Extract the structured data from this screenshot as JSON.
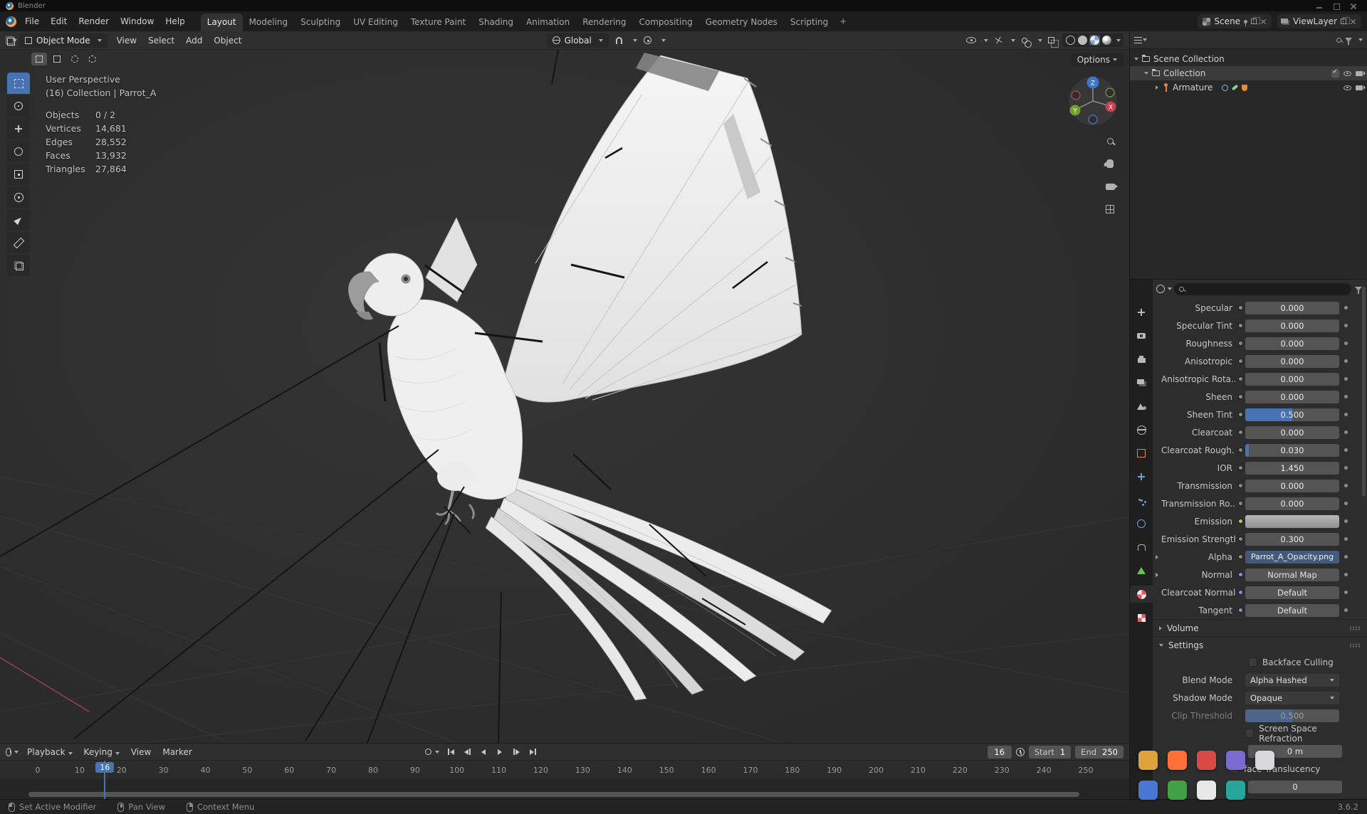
{
  "accent": "#4772b3",
  "titlebar": {
    "title": "Blender"
  },
  "topbar": {
    "menus": [
      "File",
      "Edit",
      "Render",
      "Window",
      "Help"
    ],
    "workspaces": [
      "Layout",
      "Modeling",
      "Sculpting",
      "UV Editing",
      "Texture Paint",
      "Shading",
      "Animation",
      "Rendering",
      "Compositing",
      "Geometry Nodes",
      "Scripting"
    ],
    "active_workspace": "Layout",
    "add_tab": "+",
    "scene_name": "Scene",
    "view_layer_name": "ViewLayer"
  },
  "viewport_header": {
    "mode": "Object Mode",
    "menus": [
      "View",
      "Select",
      "Add",
      "Object"
    ],
    "orientation": "Global",
    "options": "Options"
  },
  "viewport": {
    "overlay": {
      "line1": "User Perspective",
      "line2": "(16) Collection | Parrot_A",
      "stats": [
        {
          "label": "Objects",
          "value": "0 / 2"
        },
        {
          "label": "Vertices",
          "value": "14,681"
        },
        {
          "label": "Edges",
          "value": "28,552"
        },
        {
          "label": "Faces",
          "value": "13,932"
        },
        {
          "label": "Triangles",
          "value": "27,864"
        }
      ]
    },
    "axis": {
      "x": "X",
      "y": "Y",
      "z": "Z"
    },
    "tools": [
      {
        "name": "select-box-tool",
        "kind": "dashed-square",
        "active": true
      },
      {
        "name": "cursor-tool",
        "kind": "circle-cross",
        "active": false
      },
      {
        "name": "move-tool",
        "kind": "cross",
        "active": false
      },
      {
        "name": "rotate-tool",
        "kind": "ring",
        "active": false
      },
      {
        "name": "scale-tool",
        "kind": "square-dot",
        "active": false
      },
      {
        "name": "transform-tool",
        "kind": "ring-dot",
        "active": false
      },
      {
        "name": "annotate-tool",
        "kind": "pen",
        "active": false
      },
      {
        "name": "measure-tool",
        "kind": "ruler",
        "active": false
      },
      {
        "name": "add-cube-tool",
        "kind": "cube",
        "active": false
      }
    ]
  },
  "outliner": {
    "scene_collection": "Scene Collection",
    "collection": "Collection",
    "armature": "Armature"
  },
  "properties": {
    "tabs": [
      {
        "name": "tool-icon",
        "kind": "cross",
        "color": "#b8b8b8",
        "active": false
      },
      {
        "name": "render-icon",
        "kind": "camera",
        "color": "#b8b8b8",
        "active": false
      },
      {
        "name": "output-icon",
        "kind": "printer",
        "color": "#b8b8b8",
        "active": false
      },
      {
        "name": "view-layer-icon",
        "kind": "layers",
        "color": "#b8b8b8",
        "active": false
      },
      {
        "name": "scene-icon",
        "kind": "scene",
        "color": "#b8b8b8",
        "active": false
      },
      {
        "name": "world-icon",
        "kind": "globe",
        "color": "#b8b8b8",
        "active": false
      },
      {
        "name": "object-icon",
        "kind": "square-outline",
        "color": "#e8883a",
        "active": false
      },
      {
        "name": "modifiers-icon",
        "kind": "cross",
        "color": "#6f9fd8",
        "active": false
      },
      {
        "name": "particles-icon",
        "kind": "dots",
        "color": "#6f9fd8",
        "active": false
      },
      {
        "name": "physics-icon",
        "kind": "ring",
        "color": "#6f9fd8",
        "active": false
      },
      {
        "name": "constraints-icon",
        "kind": "clamp",
        "color": "#b8b8b8",
        "active": false
      },
      {
        "name": "object-data-icon",
        "kind": "triangle",
        "color": "#6cc24a",
        "active": false
      },
      {
        "name": "material-icon",
        "kind": "sphere-checker",
        "color": "#e05a5a",
        "active": true
      },
      {
        "name": "texture-icon",
        "kind": "checker",
        "color": "#e05a5a",
        "active": false
      }
    ],
    "rows": [
      {
        "type": "slider",
        "label": "Specular",
        "value": "0.000",
        "fill": 0,
        "socket": "#8c8c8c"
      },
      {
        "type": "slider",
        "label": "Specular Tint",
        "value": "0.000",
        "fill": 0,
        "socket": "#8c8c8c"
      },
      {
        "type": "slider",
        "label": "Roughness",
        "value": "0.000",
        "fill": 0,
        "socket": "#8c8c8c"
      },
      {
        "type": "slider",
        "label": "Anisotropic",
        "value": "0.000",
        "fill": 0,
        "socket": "#8c8c8c"
      },
      {
        "type": "slider",
        "label": "Anisotropic Rota...",
        "value": "0.000",
        "fill": 0,
        "socket": "#8c8c8c"
      },
      {
        "type": "slider",
        "label": "Sheen",
        "value": "0.000",
        "fill": 0,
        "socket": "#8c8c8c"
      },
      {
        "type": "slider",
        "label": "Sheen Tint",
        "value": "0.500",
        "fill": 50,
        "socket": "#8c8c8c"
      },
      {
        "type": "slider",
        "label": "Clearcoat",
        "value": "0.000",
        "fill": 0,
        "socket": "#8c8c8c"
      },
      {
        "type": "slider",
        "label": "Clearcoat Rough...",
        "value": "0.030",
        "fill": 4,
        "socket": "#8c8c8c"
      },
      {
        "type": "slider",
        "label": "IOR",
        "value": "1.450",
        "fill": 0,
        "socket": "#8c8c8c"
      },
      {
        "type": "slider",
        "label": "Transmission",
        "value": "0.000",
        "fill": 0,
        "socket": "#8c8c8c"
      },
      {
        "type": "slider",
        "label": "Transmission Ro...",
        "value": "0.000",
        "fill": 0,
        "socket": "#8c8c8c"
      },
      {
        "type": "color",
        "label": "Emission",
        "socket": "#c9c94a"
      },
      {
        "type": "slider",
        "label": "Emission Strength",
        "value": "0.300",
        "fill": 0,
        "socket": "#8c8c8c"
      },
      {
        "type": "map",
        "label": "Alpha",
        "value": "Parrot_A_Opacity.png",
        "field": "image",
        "socket": "#8c8c8c",
        "expand": true
      },
      {
        "type": "map",
        "label": "Normal",
        "value": "Normal Map",
        "field": "plain",
        "socket": "#8f8fd4",
        "expand": true
      },
      {
        "type": "map",
        "label": "Clearcoat Normal",
        "value": "Default",
        "field": "plain",
        "socket": "#8f8fd4",
        "expand": false
      },
      {
        "type": "map",
        "label": "Tangent",
        "value": "Default",
        "field": "plain",
        "socket": "#8f8fd4",
        "expand": false
      }
    ],
    "volume_section": "Volume",
    "settings_section": "Settings",
    "settings": {
      "backface": "Backface Culling",
      "blend_mode_label": "Blend Mode",
      "blend_mode_value": "Alpha Hashed",
      "shadow_mode_label": "Shadow Mode",
      "shadow_mode_value": "Opaque",
      "clip_label": "Clip Threshold",
      "clip_value": "0.500",
      "ssr_label": "Screen Space Refraction",
      "depth_value": "0 m",
      "translucency_label": "face Translucency",
      "pass_value": "0"
    }
  },
  "overlay_icons": {
    "row1": [
      {
        "name": "app-icon-yellow",
        "color": "#e0a33b"
      },
      {
        "name": "app-icon-firefox",
        "color": "#ff7139"
      },
      {
        "name": "app-icon-red",
        "color": "#d84a45"
      },
      {
        "name": "app-icon-purple",
        "color": "#7b6bd0"
      },
      {
        "name": "app-icon-pencil",
        "color": "#d8d8dc"
      }
    ],
    "row2": [
      {
        "name": "app-icon-blue",
        "color": "#4a77d4"
      },
      {
        "name": "app-icon-green",
        "color": "#43a047"
      },
      {
        "name": "app-icon-white",
        "color": "#e8e8e8"
      },
      {
        "name": "app-icon-teal",
        "color": "#26a69a"
      }
    ]
  },
  "timeline": {
    "menus": [
      {
        "label": "Playback",
        "caret": true
      },
      {
        "label": "Keying",
        "caret": true
      },
      {
        "label": "View",
        "caret": false
      },
      {
        "label": "Marker",
        "caret": false
      }
    ],
    "current_frame": "16",
    "frame_field": "16",
    "start_label": "Start",
    "start_value": "1",
    "end_label": "End",
    "end_value": "250",
    "tick_frames": [
      0,
      10,
      20,
      30,
      40,
      50,
      60,
      70,
      80,
      90,
      100,
      110,
      120,
      130,
      140,
      150,
      160,
      170,
      180,
      190,
      200,
      210,
      220,
      230,
      240,
      250
    ]
  },
  "statusbar": {
    "hints": [
      {
        "icon": "mouse-left-icon",
        "label": "Set Active Modifier"
      },
      {
        "icon": "mouse-middle-icon",
        "label": "Pan View"
      },
      {
        "icon": "mouse-right-icon",
        "label": "Context Menu"
      }
    ],
    "version": "3.6.2"
  }
}
